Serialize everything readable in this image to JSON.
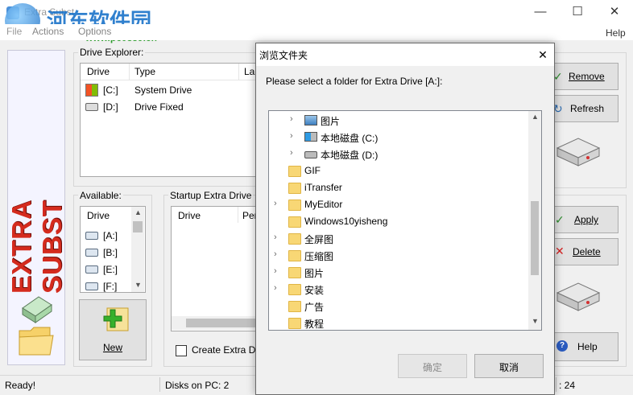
{
  "window": {
    "title": "Extra Subst",
    "watermark": {
      "site_name": "河东软件园",
      "url": "www.pc0359.cn"
    },
    "controls": {
      "minimize": "—",
      "maximize": "☐",
      "close": "✕"
    }
  },
  "menu": {
    "file": "File",
    "actions": "Actions",
    "options": "Options",
    "help": "Help"
  },
  "banner": {
    "text": "EXTRA SUBST"
  },
  "drive_explorer": {
    "label": "Drive Explorer:",
    "columns": [
      "Drive",
      "Type",
      "La"
    ],
    "rows": [
      {
        "drive": "[C:]",
        "type": "System Drive"
      },
      {
        "drive": "[D:]",
        "type": "Drive Fixed"
      }
    ]
  },
  "available": {
    "label": "Available:",
    "column": "Drive",
    "items": [
      "[A:]",
      "[B:]",
      "[E:]",
      "[F:]"
    ]
  },
  "startup": {
    "label": "Startup Extra Drive",
    "columns": [
      "Drive",
      "Per"
    ],
    "checkbox_label": "Create Extra D"
  },
  "buttons": {
    "new": "New",
    "remove": "Remove",
    "refresh": "Refresh",
    "apply": "Apply",
    "delete": "Delete",
    "help": "Help"
  },
  "status": {
    "ready": "Ready!",
    "disks": "Disks on PC: 2",
    "right_value": ": 24"
  },
  "dialog": {
    "title": "浏览文件夹",
    "prompt": "Please select a folder for Extra Drive [A:]:",
    "tree": [
      {
        "label": "图片",
        "indent": 1,
        "expander": true,
        "icon": "picture-folder-icon"
      },
      {
        "label": "本地磁盘 (C:)",
        "indent": 1,
        "expander": true,
        "icon": "system-drive-icon"
      },
      {
        "label": "本地磁盘 (D:)",
        "indent": 1,
        "expander": true,
        "icon": "drive-icon"
      },
      {
        "label": "GIF",
        "indent": 0,
        "expander": false,
        "icon": "folder-icon"
      },
      {
        "label": "iTransfer",
        "indent": 0,
        "expander": false,
        "icon": "folder-icon"
      },
      {
        "label": "MyEditor",
        "indent": 0,
        "expander": true,
        "icon": "folder-icon"
      },
      {
        "label": "Windows10yisheng",
        "indent": 0,
        "expander": false,
        "icon": "folder-icon"
      },
      {
        "label": "全屏图",
        "indent": 0,
        "expander": true,
        "icon": "folder-icon"
      },
      {
        "label": "压缩图",
        "indent": 0,
        "expander": true,
        "icon": "folder-icon"
      },
      {
        "label": "图片",
        "indent": 0,
        "expander": true,
        "icon": "folder-icon"
      },
      {
        "label": "安装",
        "indent": 0,
        "expander": true,
        "icon": "folder-icon"
      },
      {
        "label": "广告",
        "indent": 0,
        "expander": false,
        "icon": "folder-icon"
      },
      {
        "label": "教程",
        "indent": 0,
        "expander": false,
        "icon": "folder-icon"
      }
    ],
    "ok": "确定",
    "cancel": "取消"
  }
}
